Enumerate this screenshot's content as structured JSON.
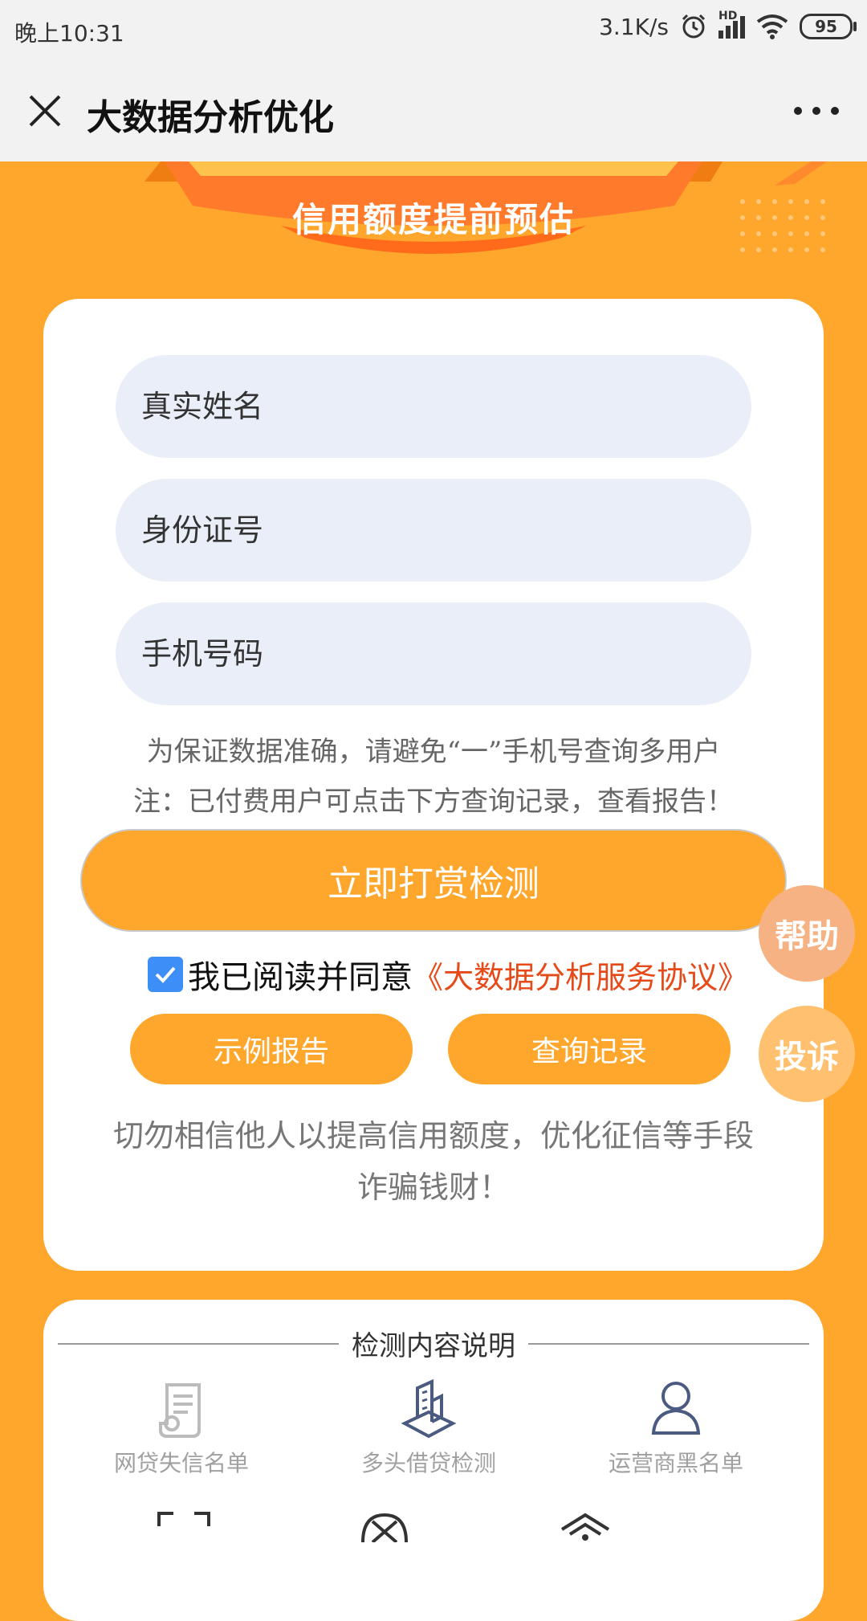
{
  "status_bar": {
    "time": "晚上10:31",
    "net_speed": "3.1K/s",
    "hd_label": "HD",
    "battery": "95"
  },
  "title_bar": {
    "title": "大数据分析优化"
  },
  "banner": {
    "title": "信用额度提前预估"
  },
  "form": {
    "name_placeholder": "真实姓名",
    "id_placeholder": "身份证号",
    "phone_placeholder": "手机号码",
    "notice_line1": "为保证数据准确，请避免“一”手机号查询多用户",
    "notice_line2": "注：已付费用户可点击下方查询记录，查看报告！",
    "submit_label": "立即打赏检测",
    "agree_text": "我已阅读并同意",
    "agreement_link": "《大数据分析服务协议》",
    "sample_report_label": "示例报告",
    "query_record_label": "查询记录",
    "warning_line1": "切勿相信他人以提高信用额度，优化征信等手段",
    "warning_line2": "诈骗钱财！"
  },
  "floating": {
    "help": "帮助",
    "complaint": "投诉"
  },
  "detect": {
    "title": "检测内容说明",
    "items": [
      {
        "label": "网贷失信名单",
        "icon": "document-stack-icon"
      },
      {
        "label": "多头借贷检测",
        "icon": "building-icon"
      },
      {
        "label": "运营商黑名单",
        "icon": "user-group-icon"
      }
    ]
  },
  "colors": {
    "accent": "#ffa62c",
    "link": "#e64a19",
    "field_bg": "#e9eef8",
    "checkbox": "#3e8ef7"
  }
}
